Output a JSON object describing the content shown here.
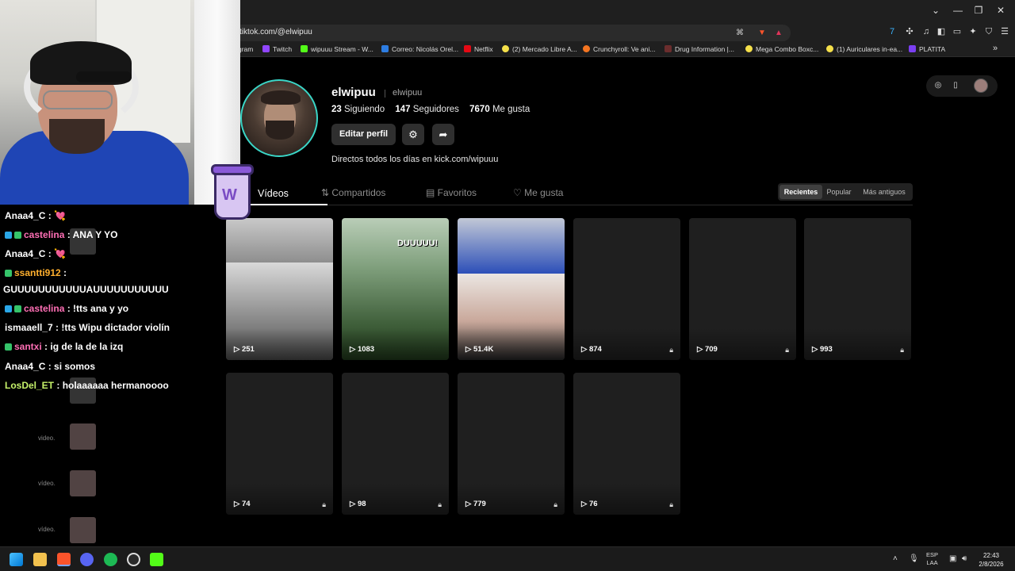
{
  "browser": {
    "url": "tiktok.com/@elwipuu",
    "window_controls": [
      "⌄",
      "—",
      "❐",
      "✕"
    ],
    "bookmarks": [
      {
        "label": "gram",
        "color": "#d04bd8"
      },
      {
        "label": "Twitch",
        "color": "#9146ff"
      },
      {
        "label": "wipuuu Stream - W...",
        "color": "#53fc18"
      },
      {
        "label": "Correo: Nicolás Orel...",
        "color": "#2d7de2"
      },
      {
        "label": "Netflix",
        "color": "#e50914"
      },
      {
        "label": "(2) Mercado Libre A...",
        "color": "#f5e04a"
      },
      {
        "label": "Crunchyroll: Ve ani...",
        "color": "#f47521"
      },
      {
        "label": "Drug Information |...",
        "color": "#6b2d2d"
      },
      {
        "label": "Mega Combo Boxc...",
        "color": "#f5e04a"
      },
      {
        "label": "(1) Auriculares in-ea...",
        "color": "#f5e04a"
      },
      {
        "label": "PLATITA",
        "color": "#7b3ff2"
      }
    ]
  },
  "profile": {
    "username": "elwipuu",
    "handle": "elwipuu",
    "following_count": "23",
    "following_label": "Siguiendo",
    "followers_count": "147",
    "followers_label": "Seguidores",
    "likes_count": "7670",
    "likes_label": "Me gusta",
    "edit_button": "Editar perfil",
    "bio": "Directos todos los días en kick.com/wipuuu",
    "accent_ring": "#3ad6c7"
  },
  "tabs": [
    {
      "label": "Vídeos",
      "icon": "grid-icon"
    },
    {
      "label": "Compartidos",
      "icon": "repost-icon"
    },
    {
      "label": "Favoritos",
      "icon": "bookmark-icon"
    },
    {
      "label": "Me gusta",
      "icon": "heart-icon"
    }
  ],
  "sort_options": [
    "Recientes",
    "Popular",
    "Más antiguos"
  ],
  "videos": [
    {
      "views": "251",
      "locked": false
    },
    {
      "views": "1083",
      "locked": false,
      "overlay_text": "DUUUUU!"
    },
    {
      "views": "51.4K",
      "locked": false
    },
    {
      "views": "874",
      "locked": true
    },
    {
      "views": "709",
      "locked": true
    },
    {
      "views": "993",
      "locked": true
    },
    {
      "views": "74",
      "locked": true
    },
    {
      "views": "98",
      "locked": true
    },
    {
      "views": "779",
      "locked": true
    },
    {
      "views": "76",
      "locked": true
    }
  ],
  "chat": [
    {
      "user": "Anaa4_C",
      "color": "#ffffff",
      "message": "💘"
    },
    {
      "user": "castelina",
      "color": "#ff6fb5",
      "message": "ANA Y YO"
    },
    {
      "user": "Anaa4_C",
      "color": "#ffffff",
      "message": "💘"
    },
    {
      "user": "ssantti912",
      "color": "#ffb02e",
      "message": ""
    },
    {
      "user": "",
      "color": "#ffffff",
      "message": "GUUUUUUUUUUUAUUUUUUUUUUU"
    },
    {
      "user": "castelina",
      "color": "#ff6fb5",
      "message": "!tts ana y yo"
    },
    {
      "user": "ismaaell_7",
      "color": "#ffffff",
      "message": "!tts Wipu dictador violín"
    },
    {
      "user": "santxi",
      "color": "#ff6fb5",
      "message": "ig de la de la izq"
    },
    {
      "user": "Anaa4_C",
      "color": "#ffffff",
      "message": "si somos"
    },
    {
      "user": "LosDel_ET",
      "color": "#c6f26a",
      "message": "holaaaaaa hermanoooo"
    }
  ],
  "chat_ghost_text": [
    "video.",
    "vídeo.",
    "vídeo."
  ],
  "taskbar": {
    "lang_top": "ESP",
    "lang_bottom": "LAA",
    "time": "22:43",
    "date": "2/8/2026"
  }
}
